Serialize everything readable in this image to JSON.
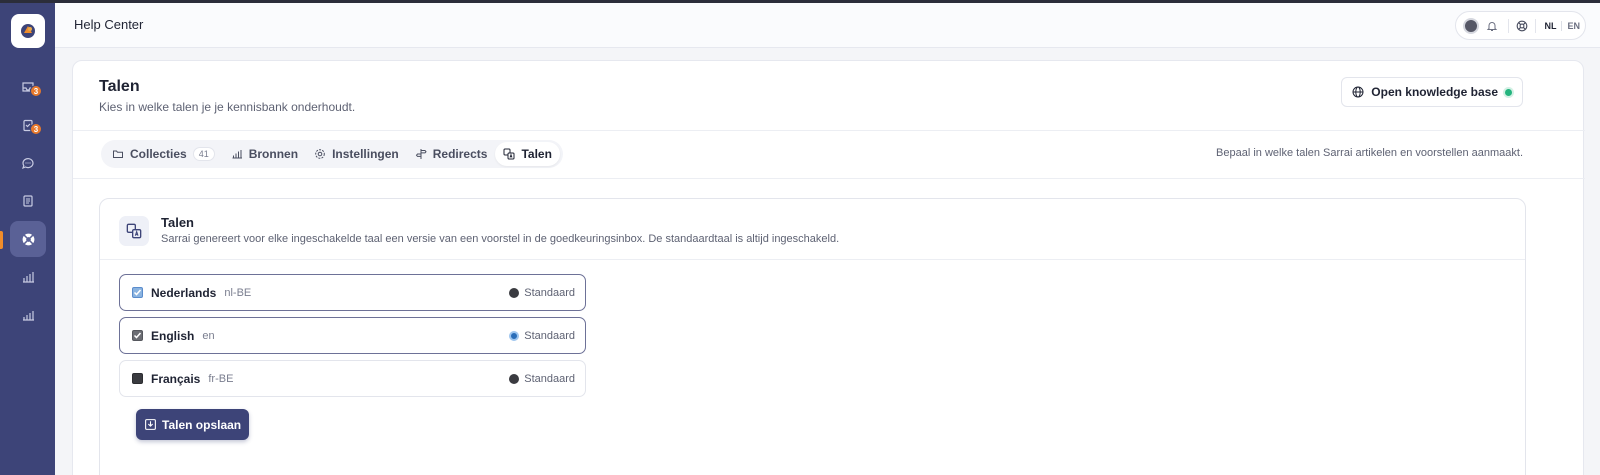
{
  "topbar": {
    "title": "Help Center",
    "languages": [
      "NL",
      "EN"
    ],
    "active_language": "NL"
  },
  "sidebar": {
    "items": [
      {
        "icon": "inbox-icon",
        "badge": "3"
      },
      {
        "icon": "clipboard-icon",
        "badge": "3"
      },
      {
        "icon": "chat-icon"
      },
      {
        "icon": "document-icon"
      },
      {
        "icon": "lifebuoy-icon",
        "active": true
      },
      {
        "icon": "bar-chart-icon"
      },
      {
        "icon": "bar-chart-icon"
      }
    ],
    "accent": "#f08c2a"
  },
  "header": {
    "title": "Talen",
    "subtitle": "Kies in welke talen je je kennisbank onderhoudt.",
    "open_kb_label": "Open knowledge base",
    "status_color": "#24b47e"
  },
  "tabs": {
    "items": [
      {
        "label": "Collecties",
        "count": "41",
        "icon": "folder-icon"
      },
      {
        "label": "Bronnen",
        "icon": "bar-chart-icon"
      },
      {
        "label": "Instellingen",
        "icon": "gear-icon"
      },
      {
        "label": "Redirects",
        "icon": "signpost-icon"
      },
      {
        "label": "Talen",
        "icon": "translate-icon",
        "active": true
      }
    ],
    "hint": "Bepaal in welke talen Sarrai artikelen en voorstellen aanmaakt."
  },
  "section": {
    "title": "Talen",
    "description": "Sarrai genereert voor elke ingeschakelde taal een versie van een voorstel in de goedkeuringsinbox. De standaardtaal is altijd ingeschakeld.",
    "languages": [
      {
        "name": "Nederlands",
        "code": "nl-BE",
        "default_label": "Standaard",
        "checked": true,
        "is_default": false
      },
      {
        "name": "English",
        "code": "en",
        "default_label": "Standaard",
        "checked": true,
        "is_default": true
      },
      {
        "name": "Français",
        "code": "fr-BE",
        "default_label": "Standaard",
        "checked": false,
        "is_default": false
      }
    ],
    "save_label": "Talen opslaan"
  },
  "colors": {
    "sidebar": "#3d4478",
    "primary_button": "#3d4478"
  }
}
